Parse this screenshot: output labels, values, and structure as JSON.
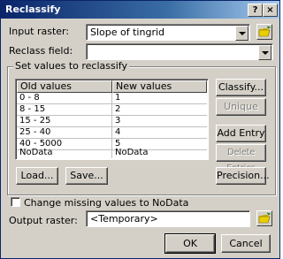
{
  "window": {
    "title": "Reclassify",
    "help_glyph": "?",
    "close_glyph": "×"
  },
  "input_raster": {
    "label": "Input raster:",
    "value": "Slope of tingrid"
  },
  "reclass_field": {
    "label": "Reclass field:",
    "value": ""
  },
  "group": {
    "label": "Set values to reclassify"
  },
  "table": {
    "headers": [
      "Old values",
      "New values"
    ],
    "rows": [
      [
        "0 - 8",
        "1"
      ],
      [
        "8 - 15",
        "2"
      ],
      [
        "15 - 25",
        "3"
      ],
      [
        "25 - 40",
        "4"
      ],
      [
        "40 - 5000",
        "5"
      ],
      [
        "NoData",
        "NoData"
      ]
    ]
  },
  "buttons": {
    "classify": "Classify...",
    "unique": "Unique",
    "add_entry": "Add Entry",
    "delete_entries": "Delete Entries",
    "load": "Load...",
    "save": "Save...",
    "precision": "Precision...",
    "ok": "OK",
    "cancel": "Cancel"
  },
  "checkbox": {
    "label": "Change missing values to NoData",
    "checked": false
  },
  "output_raster": {
    "label": "Output raster:",
    "value": "<Temporary>"
  },
  "icons": {
    "folder": "open-folder-icon"
  }
}
